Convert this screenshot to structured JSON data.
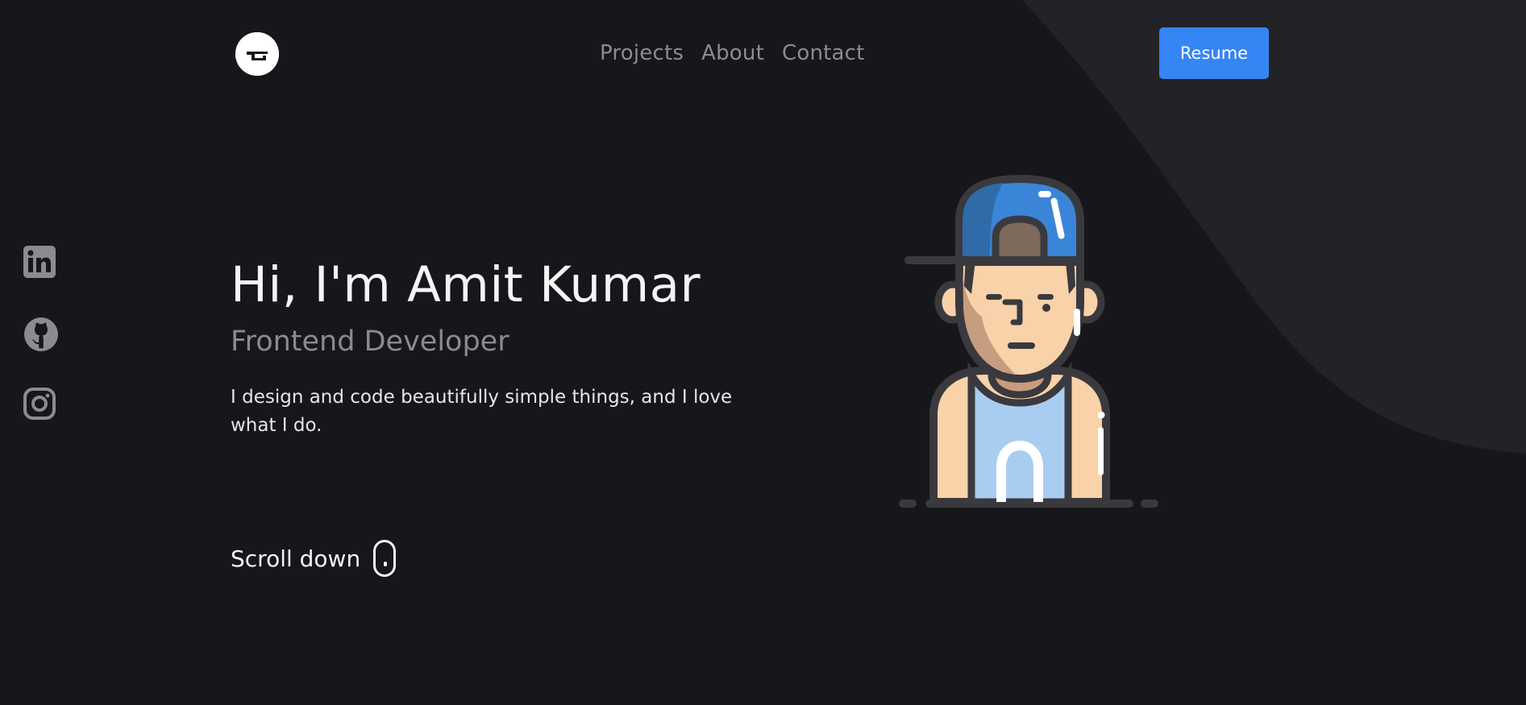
{
  "nav": {
    "links": [
      "Projects",
      "About",
      "Contact"
    ],
    "resume_label": "Resume"
  },
  "socials": [
    {
      "icon": "linkedin-icon"
    },
    {
      "icon": "github-icon"
    },
    {
      "icon": "instagram-icon"
    }
  ],
  "hero": {
    "title": "Hi, I'm Amit Kumar",
    "subtitle": "Frontend Developer",
    "description": "I design and code beautifully simple things, and I love what I do."
  },
  "scroll": {
    "label": "Scroll down"
  },
  "colors": {
    "background": "#17161b",
    "curve": "#232227",
    "accent": "#3585f5",
    "muted_text": "#8c8b91"
  }
}
